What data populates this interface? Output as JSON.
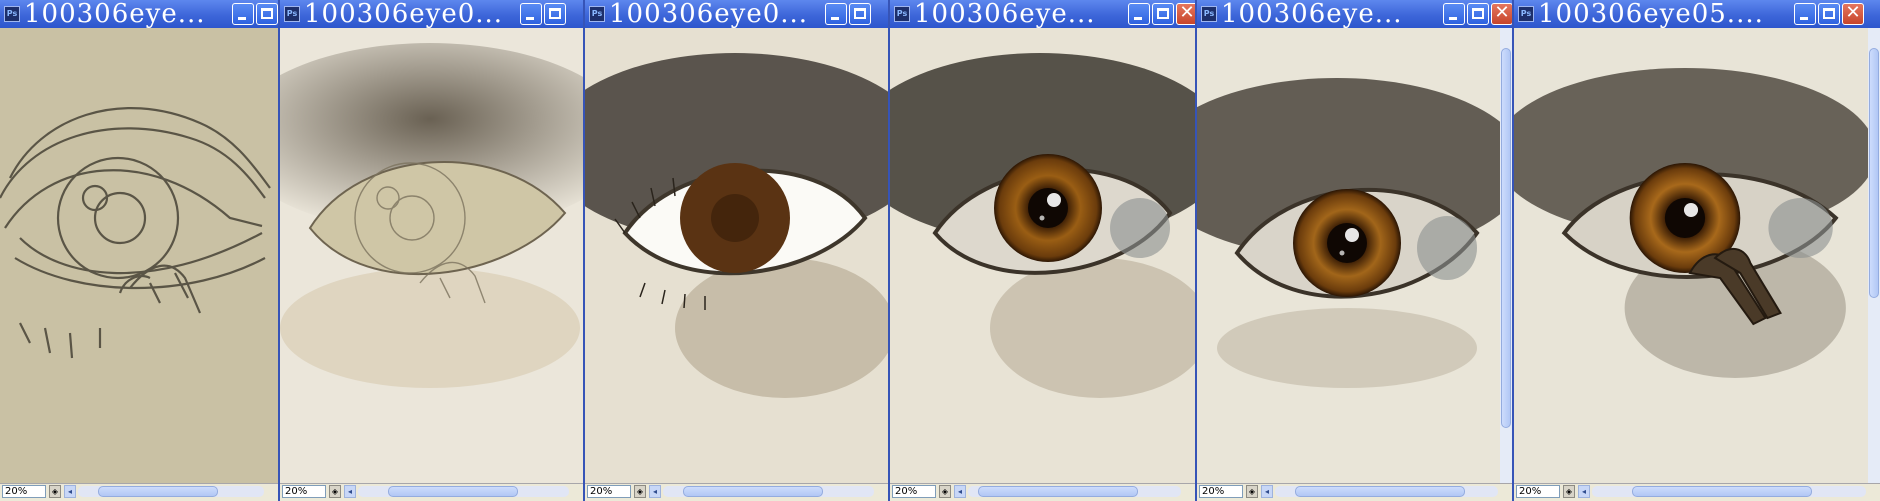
{
  "windows": [
    {
      "title": "100306eye...",
      "zoom": "20%",
      "stage": "sketch"
    },
    {
      "title": "100306eye0...",
      "zoom": "20%",
      "stage": "base-shading"
    },
    {
      "title": "100306eye0...",
      "zoom": "20%",
      "stage": "flat-iris"
    },
    {
      "title": "100306eye...",
      "zoom": "20%",
      "stage": "detailed-iris"
    },
    {
      "title": "100306eye...",
      "zoom": "20%",
      "stage": "refined"
    },
    {
      "title": "100306eye05....",
      "zoom": "20%",
      "stage": "final"
    }
  ],
  "icons": {
    "app": "ps-document-icon",
    "minimize": "minimize-icon",
    "maximize": "maximize-icon",
    "close": "close-icon"
  },
  "colors": {
    "titlebar": "#3d66d9",
    "skin": "#e9e4d6",
    "sketch_bg": "#c9c1a4",
    "iris": "#6b3c12"
  }
}
